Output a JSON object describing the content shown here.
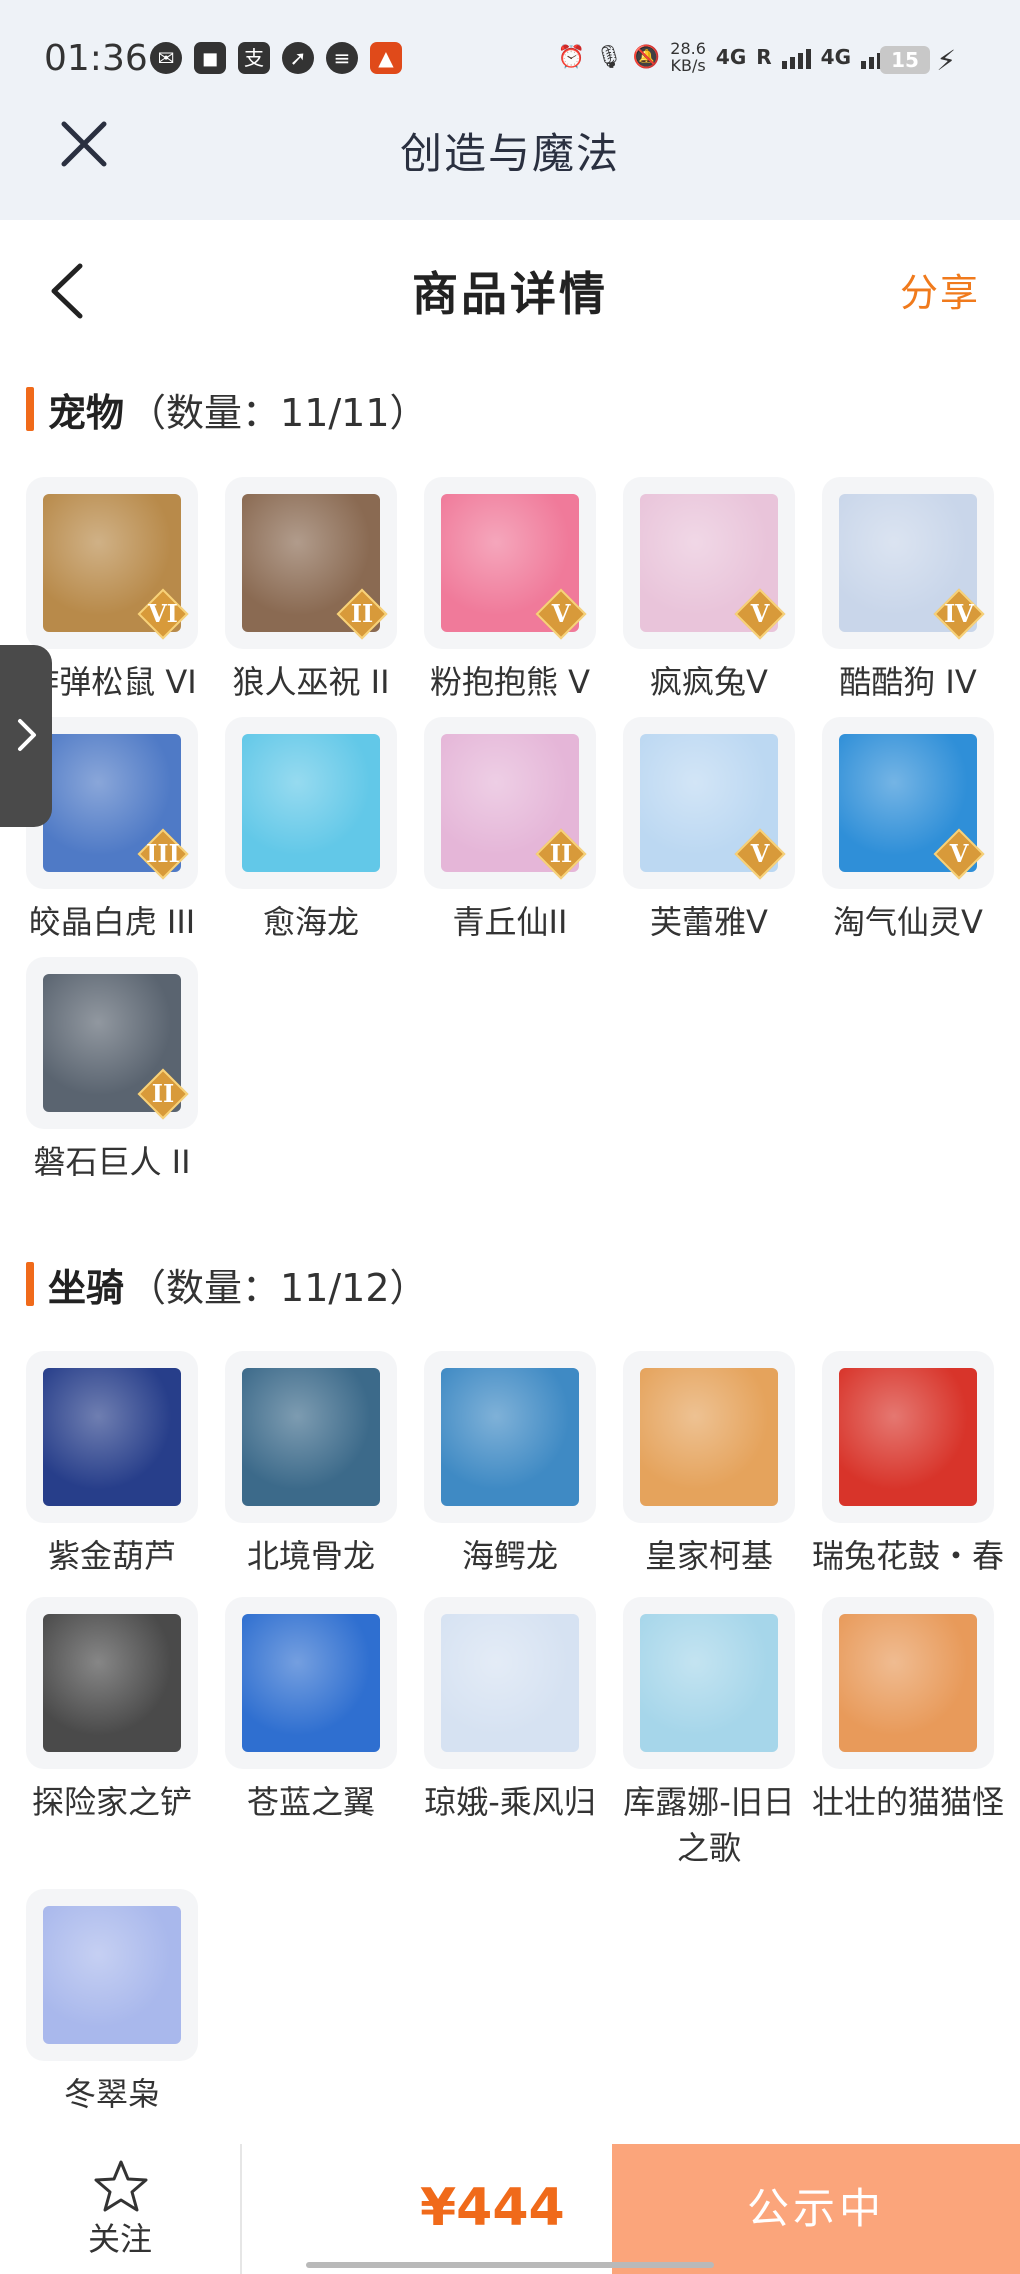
{
  "status_bar": {
    "time": "01:36",
    "speed_value": "28.6",
    "speed_unit": "KB/s",
    "net_1": "4G",
    "net_r": "R",
    "net_2": "4G",
    "battery": "15",
    "left_icons": [
      "wechat-icon",
      "app-icon",
      "alipay-icon",
      "compass-icon",
      "app-icon",
      "app-icon"
    ]
  },
  "app_bar": {
    "title": "创造与魔法"
  },
  "page": {
    "title": "商品详情",
    "share_label": "分享"
  },
  "pets": {
    "name": "宠物",
    "count": "（数量：11/11）",
    "items": [
      {
        "label": "炸弹松鼠 VI",
        "tier": "VI",
        "color": "#b88a4a"
      },
      {
        "label": "狼人巫祝 II",
        "tier": "II",
        "color": "#8a6a52"
      },
      {
        "label": "粉抱抱熊 V",
        "tier": "V",
        "color": "#f07a9a"
      },
      {
        "label": "疯疯兔V",
        "tier": "V",
        "color": "#e9c4da"
      },
      {
        "label": "酷酷狗 IV",
        "tier": "IV",
        "color": "#c9d6ea"
      },
      {
        "label": "皎晶白虎 III",
        "tier": "III",
        "color": "#4f7ac6"
      },
      {
        "label": "愈海龙",
        "tier": "",
        "color": "#62c8e8"
      },
      {
        "label": "青丘仙II",
        "tier": "II",
        "color": "#e5b6d8"
      },
      {
        "label": "芙蕾雅V",
        "tier": "V",
        "color": "#bcd8f2"
      },
      {
        "label": "淘气仙灵V",
        "tier": "V",
        "color": "#2f8fd8"
      },
      {
        "label": "磐石巨人 II",
        "tier": "II",
        "color": "#5a6470"
      }
    ]
  },
  "mounts": {
    "name": "坐骑",
    "count": "（数量：11/12）",
    "items": [
      {
        "label": "紫金葫芦",
        "color": "#273e8a"
      },
      {
        "label": "北境骨龙",
        "color": "#3c6a8a"
      },
      {
        "label": "海鳄龙",
        "color": "#3f8ac4"
      },
      {
        "label": "皇家柯基",
        "color": "#e5a35c"
      },
      {
        "label": "瑞兔花鼓・春",
        "color": "#d8342a"
      },
      {
        "label": "探险家之铲",
        "color": "#4a4a4a"
      },
      {
        "label": "苍蓝之翼",
        "color": "#2f6fd0"
      },
      {
        "label": "琼娥-乘风归",
        "color": "#d6e2f2"
      },
      {
        "label": "库露娜-旧日之歌",
        "color": "#a6d6ea"
      },
      {
        "label": "壮壮的猫猫怪",
        "color": "#e89a5a"
      },
      {
        "label": "冬翠枭",
        "color": "#a9b8ec"
      }
    ]
  },
  "bottom_bar": {
    "follow_label": "关注",
    "price": "¥444",
    "status_label": "公示中"
  },
  "colors": {
    "accent": "#f06a1a",
    "status_button": "#fba57b",
    "share": "#f07a1c"
  }
}
